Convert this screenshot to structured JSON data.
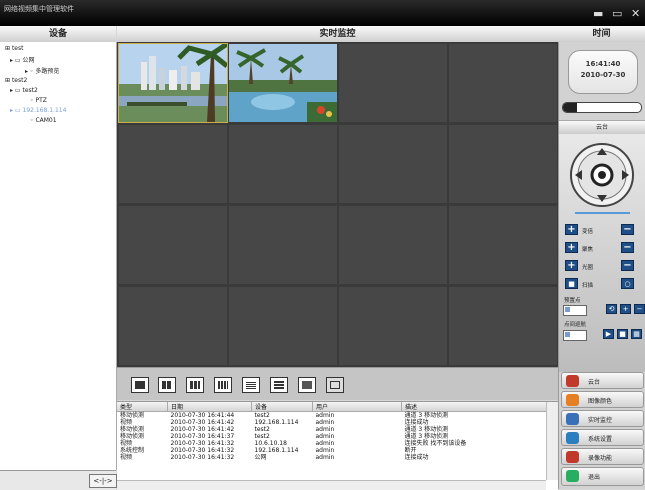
{
  "window": {
    "title": "网络视频集中管理软件",
    "min_glyph": "▬",
    "max_glyph": "▭",
    "close_glyph": "✕"
  },
  "headers": {
    "devices": "设备",
    "live": "实时监控",
    "time": "时间"
  },
  "tree": {
    "items": [
      {
        "text": "test"
      },
      {
        "text": "公网"
      },
      {
        "text": "多路预览"
      },
      {
        "text": "test2"
      },
      {
        "text": "test2"
      },
      {
        "text": "PTZ"
      },
      {
        "text": "192.168.1.114"
      },
      {
        "text": "CAM01"
      }
    ],
    "scroll_arrows": "<-|->"
  },
  "clock": {
    "time": "16:41:40",
    "date": "2010-07-30"
  },
  "progress": {
    "value": 0.18
  },
  "ptz": {
    "header": "云台",
    "focus": "变倍",
    "zoom": "聚焦",
    "iris": "光圈",
    "scan": "扫描",
    "preset_label": "预置点",
    "cruise_label": "点间巡航"
  },
  "nav": [
    {
      "label": "云台",
      "icon": "ptz-icon",
      "color": "#c0392b"
    },
    {
      "label": "图像颜色",
      "icon": "color-icon",
      "color": "#e67e22"
    },
    {
      "label": "实时监控",
      "icon": "monitor-icon",
      "color": "#3b6fb6"
    },
    {
      "label": "系统设置",
      "icon": "settings-icon",
      "color": "#2c7fbf"
    },
    {
      "label": "录像功能",
      "icon": "record-icon",
      "color": "#c0392b"
    },
    {
      "label": "退出",
      "icon": "exit-icon",
      "color": "#27ae60"
    }
  ],
  "log": {
    "columns": [
      "类型",
      "日期",
      "设备",
      "用户",
      "描述"
    ],
    "rows": [
      [
        "移动侦测",
        "2010-07-30 16:41:44",
        "test2",
        "admin",
        "通道 3 移动侦测"
      ],
      [
        "视频",
        "2010-07-30 16:41:42",
        "192.168.1.114",
        "admin",
        "连接成功"
      ],
      [
        "移动侦测",
        "2010-07-30 16:41:42",
        "test2",
        "admin",
        "通道 3 移动侦测"
      ],
      [
        "移动侦测",
        "2010-07-30 16:41:37",
        "test2",
        "admin",
        "通道 3 移动侦测"
      ],
      [
        "视频",
        "2010-07-30 16:41:32",
        "10.6.10.18",
        "admin",
        "连接失败 找不到该设备"
      ],
      [
        "系统控制",
        "2010-07-30 16:41:32",
        "192.168.1.114",
        "admin",
        "断开"
      ],
      [
        "视频",
        "2010-07-30 16:41:32",
        "公网",
        "admin",
        "连接成功"
      ]
    ]
  },
  "colors": {
    "selected_cell_border": "#c9b04a",
    "ptz_button": "#1f4f86",
    "tree_selected": "#7aa0d8"
  }
}
